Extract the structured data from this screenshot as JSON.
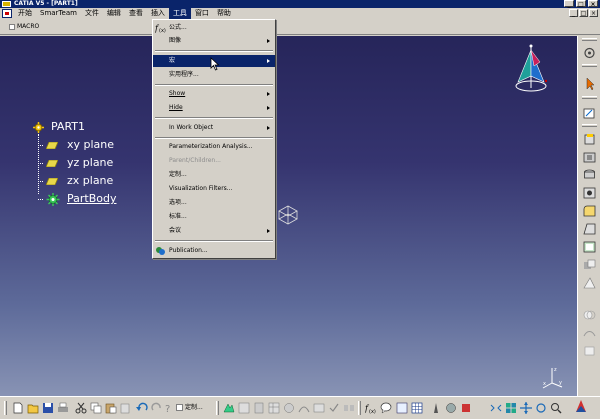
{
  "window": {
    "title": "CATIA V5 - [PART1]",
    "controls": [
      "_",
      "□",
      "×"
    ],
    "mdi_controls": [
      "_",
      "□",
      "×"
    ]
  },
  "menubar": {
    "items": [
      {
        "label": "开始"
      },
      {
        "label": "SmarTeam"
      },
      {
        "label": "文件"
      },
      {
        "label": "编辑"
      },
      {
        "label": "查看"
      },
      {
        "label": "插入"
      },
      {
        "label": "工具",
        "active": true
      },
      {
        "label": "窗口"
      },
      {
        "label": "帮助"
      }
    ]
  },
  "macro_toolbar": {
    "label": "MACRO"
  },
  "tools_menu": {
    "items": [
      {
        "label": "公式...",
        "icon": "formula-icon"
      },
      {
        "label": "图像",
        "submenu": true
      },
      {
        "label": "宏",
        "submenu": true,
        "highlighted": true
      },
      {
        "label": "实用程序..."
      },
      {
        "label": "Show",
        "submenu": true
      },
      {
        "label": "Hide",
        "submenu": true
      },
      {
        "label": "In Work Object",
        "submenu": true
      },
      {
        "label": "Parameterization Analysis..."
      },
      {
        "label": "Parent/Children...",
        "disabled": true
      },
      {
        "label": "定制..."
      },
      {
        "label": "Visualization Filters..."
      },
      {
        "label": "选项..."
      },
      {
        "label": "标准..."
      },
      {
        "label": "会议",
        "submenu": true
      },
      {
        "label": "Publication...",
        "icon": "publication-icon"
      }
    ]
  },
  "tree": {
    "root": {
      "label": "PART1",
      "icon": "part-gear-icon"
    },
    "children": [
      {
        "label": "xy plane",
        "icon": "plane-icon"
      },
      {
        "label": "yz plane",
        "icon": "plane-icon"
      },
      {
        "label": "zx plane",
        "icon": "plane-icon"
      },
      {
        "label": "PartBody",
        "icon": "partbody-gear-icon",
        "underlined": true
      }
    ]
  },
  "bottom_toolbar": {
    "customize_label": "定制..."
  },
  "colors": {
    "title_bar": "#0a246a",
    "highlight": "#0a246a",
    "viewport_top": "#26255a",
    "viewport_bottom": "#8893b4",
    "chrome": "#d4d0c8"
  }
}
